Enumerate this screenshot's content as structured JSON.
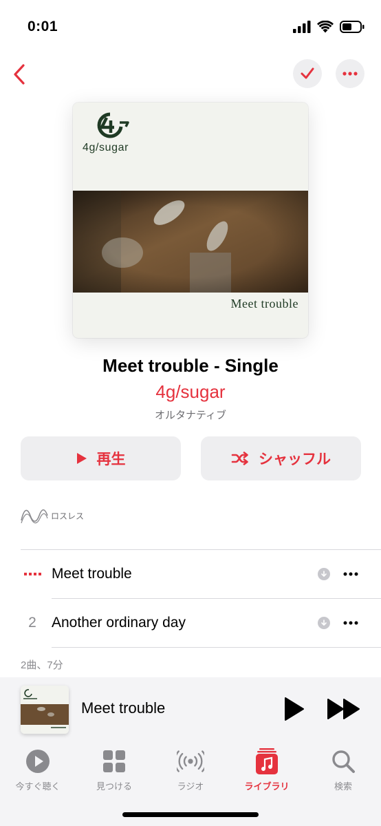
{
  "status": {
    "time": "0:01"
  },
  "album": {
    "artwork_brand": "4g/sugar",
    "artwork_title": "Meet trouble",
    "title": "Meet trouble - Single",
    "artist": "4g/sugar",
    "genre": "オルタナティブ"
  },
  "actions": {
    "play_label": "再生",
    "shuffle_label": "シャッフル"
  },
  "lossless_label": "ロスレス",
  "tracks": [
    {
      "number": "",
      "title": "Meet trouble",
      "playing": true
    },
    {
      "number": "2",
      "title": "Another ordinary day",
      "playing": false
    }
  ],
  "summary": "2曲、7分",
  "now_playing": {
    "title": "Meet trouble"
  },
  "tabs": [
    {
      "label": "今すぐ聴く",
      "icon": "play-circle-icon"
    },
    {
      "label": "見つける",
      "icon": "grid-icon"
    },
    {
      "label": "ラジオ",
      "icon": "radio-icon"
    },
    {
      "label": "ライブラリ",
      "icon": "library-icon",
      "active": true
    },
    {
      "label": "検索",
      "icon": "search-icon"
    }
  ],
  "colors": {
    "accent": "#e5323e",
    "artwork_green": "#1f3a24",
    "background": "#ffffff",
    "secondary_text": "#8a8a8e"
  }
}
